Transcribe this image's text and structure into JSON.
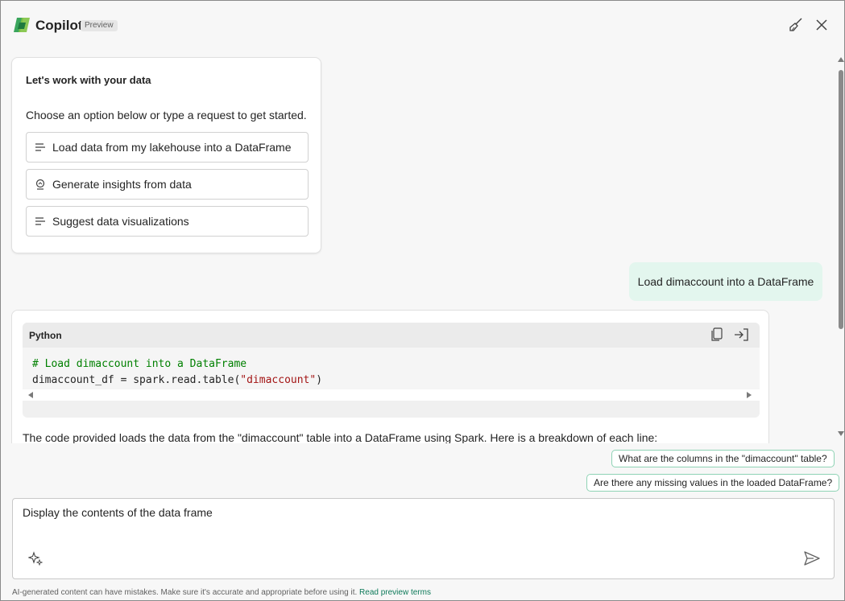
{
  "header": {
    "title": "Copilot",
    "badge": "Preview",
    "icons": {
      "logo": "copilot-logo",
      "clear": "broom-icon",
      "close": "close-icon"
    }
  },
  "welcome": {
    "title": "Let's work with your data",
    "subtitle": "Choose an option below or type a request to get started.",
    "options": [
      {
        "label": "Load data from my lakehouse into a DataFrame",
        "icon": "text-lines-icon"
      },
      {
        "label": "Generate insights from data",
        "icon": "insights-icon"
      },
      {
        "label": "Suggest data visualizations",
        "icon": "text-lines-icon"
      }
    ]
  },
  "user_message": "Load dimaccount into a DataFrame",
  "response": {
    "code": {
      "language": "Python",
      "comment": "# Load dimaccount into a DataFrame",
      "line2_prefix": "dimaccount_df = spark.read.table(",
      "line2_string": "\"dimaccount\"",
      "line2_suffix": ")",
      "icons": {
        "copy": "copy-icon",
        "insert": "insert-icon"
      }
    },
    "explanation": "The code provided loads the data from the \"dimaccount\" table into a DataFrame using Spark. Here is a breakdown of each line:"
  },
  "suggestions": [
    "What are the columns in the \"dimaccount\" table?",
    "Are there any missing values in the loaded DataFrame?"
  ],
  "input": {
    "value": "Display the contents of the data frame",
    "icons": {
      "sparkle": "sparkle-icon",
      "send": "send-icon"
    }
  },
  "footer": {
    "disclaimer": "AI-generated content can have mistakes. Make sure it's accurate and appropriate before using it.",
    "link": "Read preview terms"
  },
  "colors": {
    "accent": "#0e7a5a",
    "user_bubble": "#e3f6ee",
    "suggestion_border": "#8fd3b5"
  }
}
